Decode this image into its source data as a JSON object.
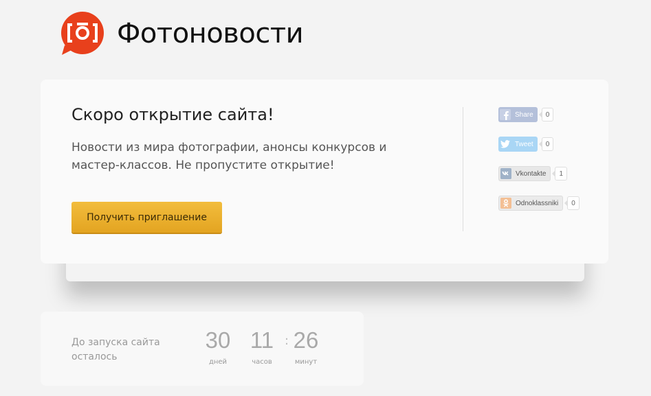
{
  "header": {
    "brand": "Фотоновости",
    "brand_color": "#e8401c"
  },
  "main": {
    "title": "Скоро открытие сайта!",
    "description": "Новости из мира фотографии, анонсы конкурсов и мастер-классов. Не пропустите открытие!",
    "invite_button": "Получить приглашение",
    "accent_color": "#eab02f"
  },
  "shares": [
    {
      "network": "facebook",
      "icon": "facebook-icon",
      "label": "Share",
      "count": "0"
    },
    {
      "network": "twitter",
      "icon": "twitter-icon",
      "label": "Tweet",
      "count": "0"
    },
    {
      "network": "vkontakte",
      "icon": "vk-icon",
      "label": "Vkontakte",
      "count": "1"
    },
    {
      "network": "odnoklassniki",
      "icon": "odnoklassniki-icon",
      "label": "Odnoklassniki",
      "count": "0"
    }
  ],
  "countdown": {
    "label": "До запуска сайта осталось",
    "days": {
      "value": "30",
      "label": "дней"
    },
    "hours": {
      "value": "11",
      "label": "часов"
    },
    "minutes": {
      "value": "26",
      "label": "минут"
    },
    "separator": ":"
  }
}
